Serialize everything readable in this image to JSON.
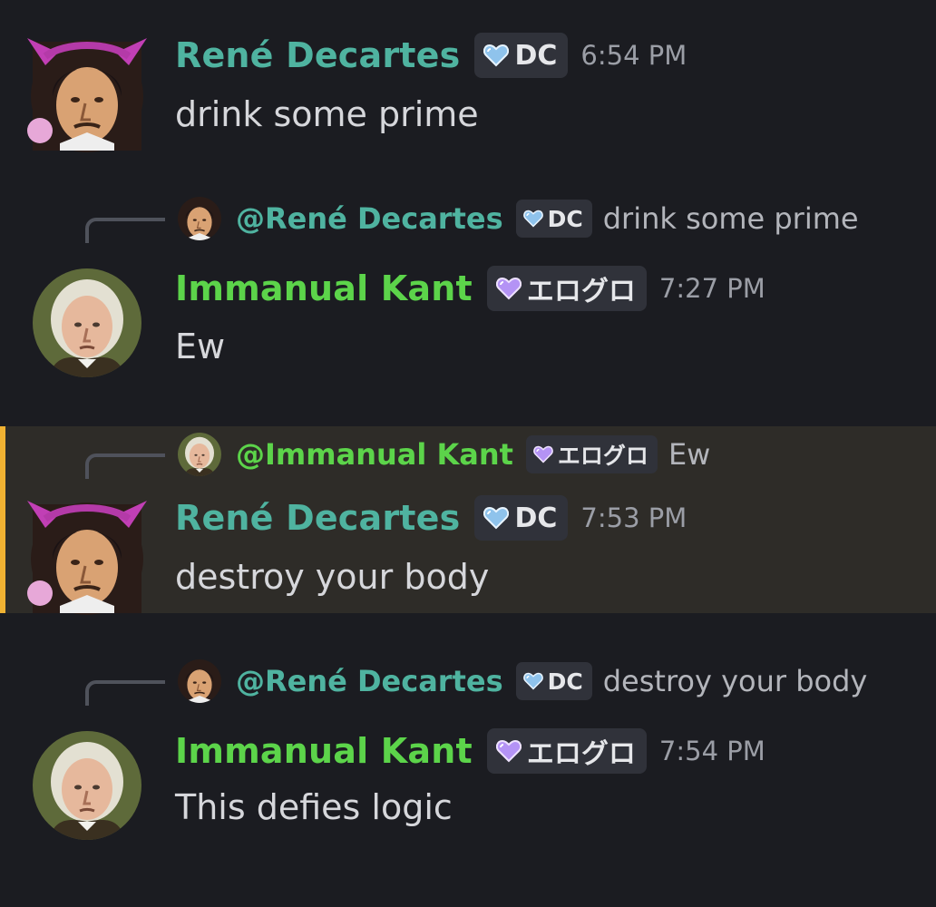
{
  "messages": [
    {
      "author": "René Decartes",
      "tag": "DC",
      "time": "6:54 PM",
      "text": "drink some prime"
    },
    {
      "reply": {
        "mention": "@René Decartes",
        "tag": "DC",
        "text": "drink some prime"
      },
      "author": "Immanual Kant",
      "tag": "エログロ",
      "time": "7:27 PM",
      "text": "Ew"
    },
    {
      "reply": {
        "mention": "@Immanual Kant",
        "tag": "エログロ",
        "text": "Ew"
      },
      "author": "René Decartes",
      "tag": "DC",
      "time": "7:53 PM",
      "text": "destroy your body"
    },
    {
      "reply": {
        "mention": "@René Decartes",
        "tag": "DC",
        "text": "destroy your body"
      },
      "author": "Immanual Kant",
      "tag": "エログロ",
      "time": "7:54 PM",
      "text": "This defies logic"
    }
  ],
  "colors": {
    "background": "#1b1c21",
    "highlight": "#2e2c28",
    "highlight_bar": "#f0b232",
    "rene_name": "#4fb3a0",
    "kant_name": "#5cd44a",
    "dc_heart": "#a9d4f5",
    "erogro_heart": "#c9a8ff"
  },
  "icons": {
    "dc_tag": "blue-heart-icon",
    "erogro_tag": "purple-heart-icon"
  }
}
